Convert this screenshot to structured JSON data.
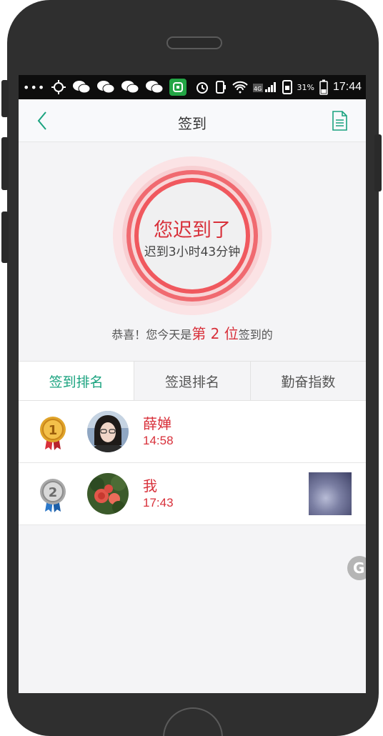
{
  "status_bar": {
    "time": "17:44",
    "battery": "31%",
    "network": "4G",
    "dots": "•••"
  },
  "nav": {
    "title": "签到",
    "back_icon": "chevron-left-icon",
    "doc_icon": "document-icon"
  },
  "checkin": {
    "status_title": "您迟到了",
    "late_text": "迟到3小时43分钟",
    "congrats_prefix": "恭喜！您今天是",
    "rank_text": "第 2 位",
    "congrats_suffix": "签到的"
  },
  "tabs": [
    {
      "label": "签到排名",
      "active": true
    },
    {
      "label": "签退排名",
      "active": false
    },
    {
      "label": "勤奋指数",
      "active": false
    }
  ],
  "ranking": [
    {
      "rank": "1",
      "name": "薛婵",
      "time": "14:58"
    },
    {
      "rank": "2",
      "name": "我",
      "time": "17:43"
    }
  ],
  "floating": {
    "label": "G"
  },
  "colors": {
    "accent_green": "#1aa37f",
    "alert_red": "#d8303a",
    "ring_red": "#f0585e"
  }
}
